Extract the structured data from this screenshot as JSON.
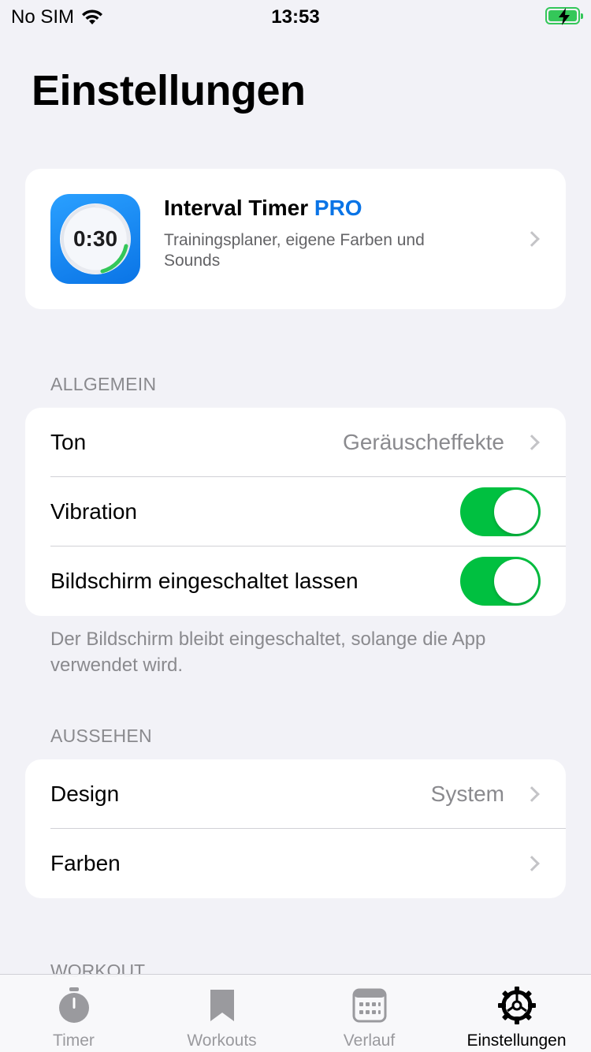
{
  "status": {
    "carrier": "No SIM",
    "time": "13:53"
  },
  "page_title": "Einstellungen",
  "pro_card": {
    "title": "Interval Timer",
    "title_badge": "PRO",
    "subtitle": "Trainingsplaner, eigene Farben und Sounds",
    "icon_text": "0:30"
  },
  "general": {
    "header": "ALLGEMEIN",
    "rows": [
      {
        "label": "Ton",
        "value": "Geräuscheffekte"
      },
      {
        "label": "Vibration",
        "on": true
      },
      {
        "label": "Bildschirm eingeschaltet lassen",
        "on": true
      }
    ],
    "footer": "Der Bildschirm bleibt eingeschaltet, solange die App verwendet wird."
  },
  "appearance": {
    "header": "AUSSEHEN",
    "rows": [
      {
        "label": "Design",
        "value": "System"
      },
      {
        "label": "Farben"
      }
    ]
  },
  "workout_header": "WORKOUT",
  "tabs": [
    {
      "label": "Timer",
      "icon": "stopwatch-icon"
    },
    {
      "label": "Workouts",
      "icon": "bookmark-icon"
    },
    {
      "label": "Verlauf",
      "icon": "calendar-icon"
    },
    {
      "label": "Einstellungen",
      "icon": "gear-icon",
      "active": true
    }
  ],
  "colors": {
    "accent": "#0a74e6",
    "toggle_on": "#00c040",
    "background": "#f2f2f7"
  }
}
